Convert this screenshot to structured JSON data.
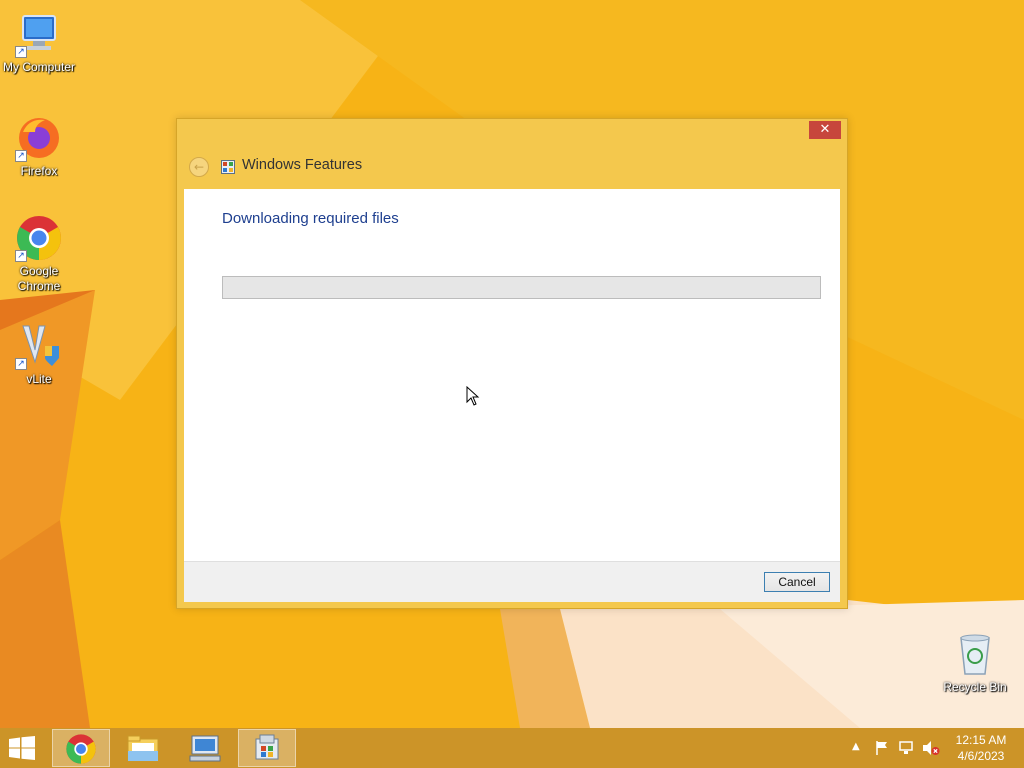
{
  "desktop": {
    "icons": [
      {
        "label": "My Computer",
        "icon": "computer-icon"
      },
      {
        "label": "Firefox",
        "icon": "firefox-icon"
      },
      {
        "label": "Google Chrome",
        "icon": "chrome-icon"
      },
      {
        "label": "vLite",
        "icon": "vlite-icon"
      },
      {
        "label": "Recycle Bin",
        "icon": "recycle-bin-icon"
      }
    ]
  },
  "dialog": {
    "title": "Windows Features",
    "heading": "Downloading required files",
    "progress": 0,
    "close_label": "✕",
    "cancel_label": "Cancel"
  },
  "taskbar": {
    "items": [
      {
        "icon": "chrome-icon",
        "active": true
      },
      {
        "icon": "file-explorer-icon",
        "active": false
      },
      {
        "icon": "remote-desktop-icon",
        "active": false
      },
      {
        "icon": "windows-features-icon",
        "active": true
      }
    ],
    "tray": {
      "time": "12:15 AM",
      "date": "4/6/2023"
    }
  },
  "colors": {
    "wallpaper": "#f7b316",
    "dialog_frame": "#f4c84d",
    "heading": "#1e3f8f",
    "close_button": "#c7463c"
  }
}
